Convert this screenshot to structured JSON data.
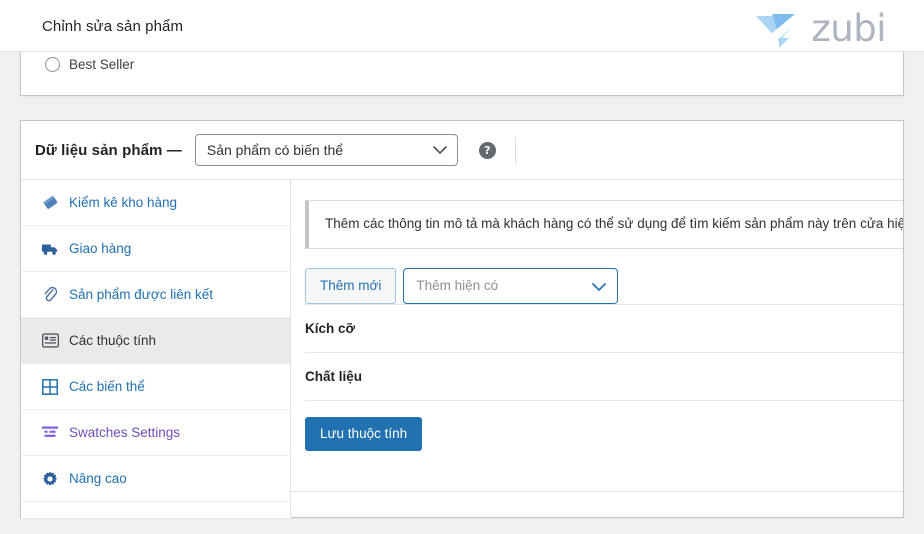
{
  "header": {
    "page_title": "Chỉnh sửa sản phẩm",
    "brand_wordmark": "zubi",
    "brand_gem_color": "#a9d4f5",
    "brand_text_color": "#aeb4c0"
  },
  "top_panel": {
    "radio_label": "Best Seller",
    "radio_checked": false
  },
  "product_data": {
    "title": "Dữ liệu sản phẩm —",
    "type_select": {
      "selected": "Sản phẩm có biến thể",
      "options": [
        "Sản phẩm có biến thể"
      ]
    },
    "help_glyph": "?",
    "tabs": [
      {
        "label": "Kiểm kê kho hàng",
        "icon": "inventory-tag-icon",
        "active": false,
        "color": "#2271b1"
      },
      {
        "label": "Giao hàng",
        "icon": "shipping-truck-icon",
        "active": false,
        "color": "#2271b1"
      },
      {
        "label": "Sản phẩm được liên kết",
        "icon": "paperclip-link-icon",
        "active": false,
        "color": "#2271b1"
      },
      {
        "label": "Các thuộc tính",
        "icon": "attributes-list-icon",
        "active": true,
        "color": "#2c3338"
      },
      {
        "label": "Các biến thể",
        "icon": "variations-grid-icon",
        "active": false,
        "color": "#2271b1"
      },
      {
        "label": "Swatches Settings",
        "icon": "swatches-sliders-icon",
        "active": false,
        "color": "#6b4fbb"
      },
      {
        "label": "Nâng cao",
        "icon": "gear-icon",
        "active": false,
        "color": "#2271b1"
      }
    ],
    "notice_text": "Thêm các thông tin mô tả mà khách hàng có thể sử dụng để tìm kiếm sản phẩm này trên cửa hiệu\".",
    "toolbar": {
      "add_new_label": "Thêm mới",
      "existing_placeholder": "Thêm hiện có"
    },
    "attributes": [
      {
        "name": "Kích cỡ"
      },
      {
        "name": "Chất liệu"
      }
    ],
    "save_attributes_label": "Lưu thuộc tính"
  },
  "colors": {
    "page_background": "#f0f0f1",
    "panel_background": "#ffffff",
    "panel_border": "#c3c4c7",
    "link_blue": "#2271b1",
    "primary_button": "#2271b1",
    "active_tab_background": "#eaeaea",
    "purple_accent": "#6b4fbb"
  }
}
